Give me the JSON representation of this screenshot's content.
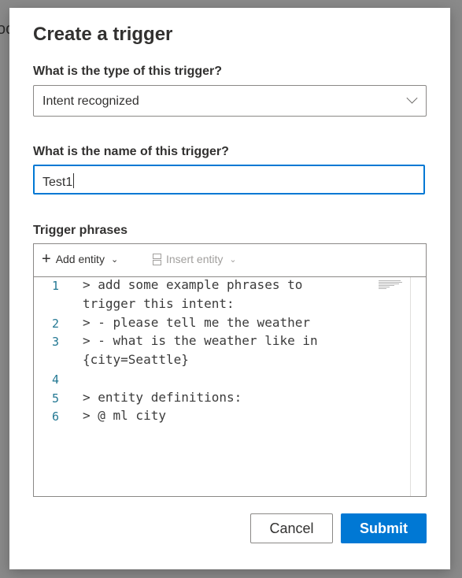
{
  "backdrop": {
    "text": "oo"
  },
  "dialog": {
    "title": "Create a trigger",
    "type_label": "What is the type of this trigger?",
    "type_value": "Intent recognized",
    "name_label": "What is the name of this trigger?",
    "name_value": "Test1",
    "phrases_label": "Trigger phrases",
    "toolbar": {
      "add_entity": "Add entity",
      "insert_entity": "Insert entity"
    },
    "code_lines": [
      {
        "num": "1",
        "text": "> add some example phrases to"
      },
      {
        "num": "",
        "text": "trigger this intent:"
      },
      {
        "num": "2",
        "text": "> - please tell me the weather"
      },
      {
        "num": "3",
        "text": "> - what is the weather like in"
      },
      {
        "num": "",
        "text": "{city=Seattle}"
      },
      {
        "num": "4",
        "text": ""
      },
      {
        "num": "5",
        "text": "> entity definitions:"
      },
      {
        "num": "6",
        "text": "> @ ml city"
      }
    ],
    "cancel_label": "Cancel",
    "submit_label": "Submit"
  },
  "colors": {
    "accent": "#0078d4",
    "line_number": "#237893",
    "overlay": "#8a8a8a"
  }
}
